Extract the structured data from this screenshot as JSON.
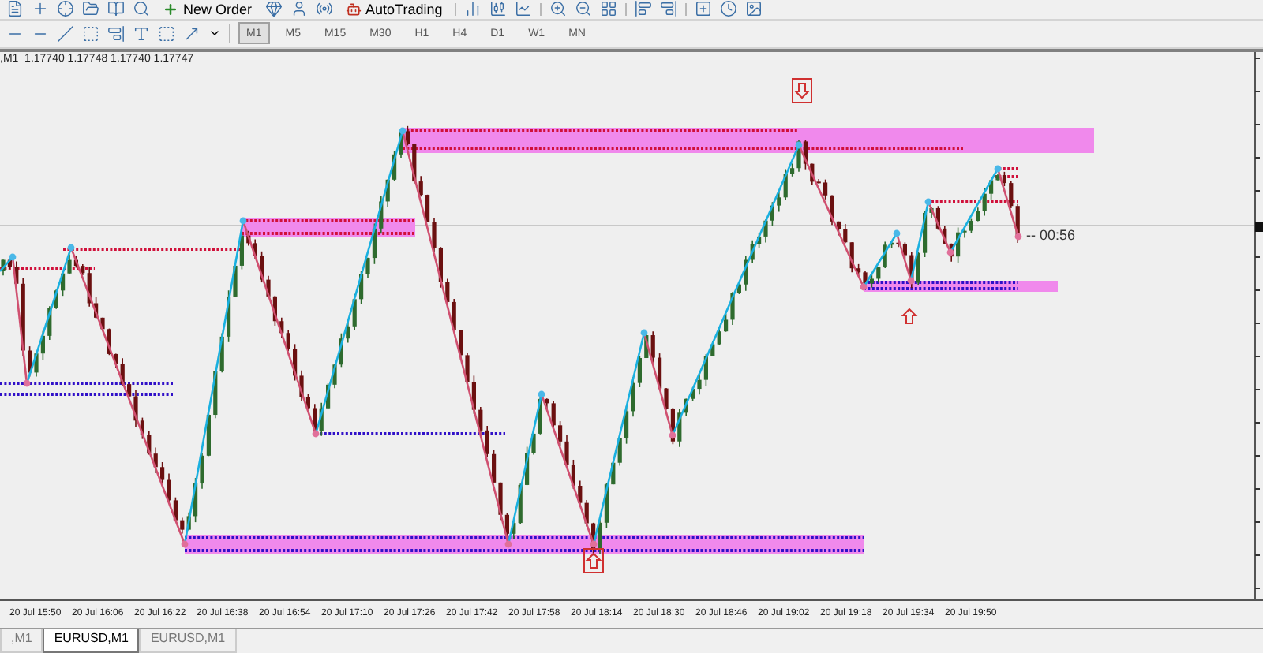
{
  "toolbar": {
    "buttons": [
      {
        "label": "New Order",
        "kind": "order"
      },
      {
        "label": "AutoTrading",
        "kind": "auto"
      }
    ]
  },
  "timeframes": [
    {
      "label": "M1",
      "selected": true
    },
    {
      "label": "M5",
      "selected": false
    },
    {
      "label": "M15",
      "selected": false
    },
    {
      "label": "M30",
      "selected": false
    },
    {
      "label": "H1",
      "selected": false
    },
    {
      "label": "H4",
      "selected": false
    },
    {
      "label": "D1",
      "selected": false
    },
    {
      "label": "W1",
      "selected": false
    },
    {
      "label": "MN",
      "selected": false
    }
  ],
  "chart": {
    "info": ",M1  1.17740 1.17748 1.17740 1.17747",
    "countdown": "-- 00:56"
  },
  "time_axis": [
    "20 Jul 15:50",
    "20 Jul 16:06",
    "20 Jul 16:22",
    "20 Jul 16:38",
    "20 Jul 16:54",
    "20 Jul 17:10",
    "20 Jul 17:26",
    "20 Jul 17:42",
    "20 Jul 17:58",
    "20 Jul 18:14",
    "20 Jul 18:30",
    "20 Jul 18:46",
    "20 Jul 19:02",
    "20 Jul 19:18",
    "20 Jul 19:34",
    "20 Jul 19:50"
  ],
  "tabs": [
    {
      "label": ",M1",
      "selected": false
    },
    {
      "label": "EURUSD,M1",
      "selected": true
    },
    {
      "label": "EURUSD,M1",
      "selected": false
    }
  ]
}
